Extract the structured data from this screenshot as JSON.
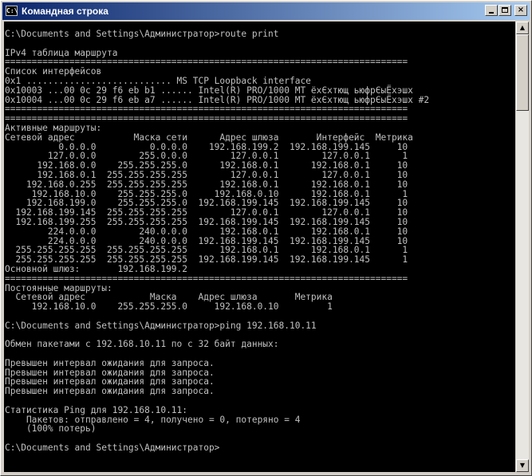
{
  "window": {
    "title": "Командная строка",
    "icon_text": "C:\\"
  },
  "titlebar_buttons": {
    "minimize_icon": "minimize-icon",
    "maximize_icon": "maximize-icon",
    "close_label": "×"
  },
  "scrollbar": {
    "up_arrow": "▲",
    "down_arrow": "▼"
  },
  "console": {
    "lines": [
      "C:\\Documents and Settings\\Администратор>route print",
      "",
      "IPv4 таблица маршрута",
      "===========================================================================",
      "Список интерфейсов",
      "0x1 ........................... MS TCP Loopback interface",
      "0x10003 ...00 0c 29 f6 eb b1 ...... Intel(R) PRO/1000 MT ёхЄхтющ ьюфрЄыЁхэшх",
      "0x10004 ...00 0c 29 f6 eb a7 ...... Intel(R) PRO/1000 MT ёхЄхтющ ьюфрЄыЁхэшх #2",
      "===========================================================================",
      "===========================================================================",
      "Активные маршруты:",
      "Сетевой адрес           Маска сети      Адрес шлюза       Интерфейс  Метрика",
      "          0.0.0.0          0.0.0.0    192.168.199.2  192.168.199.145     10",
      "        127.0.0.0        255.0.0.0        127.0.0.1        127.0.0.1      1",
      "      192.168.0.0    255.255.255.0      192.168.0.1      192.168.0.1     10",
      "      192.168.0.1  255.255.255.255        127.0.0.1        127.0.0.1     10",
      "    192.168.0.255  255.255.255.255      192.168.0.1      192.168.0.1     10",
      "     192.168.10.0    255.255.255.0     192.168.0.10      192.168.0.1      1",
      "    192.168.199.0    255.255.255.0  192.168.199.145  192.168.199.145     10",
      "  192.168.199.145  255.255.255.255        127.0.0.1        127.0.0.1     10",
      "  192.168.199.255  255.255.255.255  192.168.199.145  192.168.199.145     10",
      "        224.0.0.0        240.0.0.0      192.168.0.1      192.168.0.1     10",
      "        224.0.0.0        240.0.0.0  192.168.199.145  192.168.199.145     10",
      "  255.255.255.255  255.255.255.255      192.168.0.1      192.168.0.1      1",
      "  255.255.255.255  255.255.255.255  192.168.199.145  192.168.199.145      1",
      "Основной шлюз:       192.168.199.2",
      "===========================================================================",
      "Постоянные маршруты:",
      "  Сетевой адрес            Маска    Адрес шлюза       Метрика",
      "     192.168.10.0    255.255.255.0     192.168.0.10         1",
      "",
      "C:\\Documents and Settings\\Администратор>ping 192.168.10.11",
      "",
      "Обмен пакетами с 192.168.10.11 по с 32 байт данных:",
      "",
      "Превышен интервал ожидания для запроса.",
      "Превышен интервал ожидания для запроса.",
      "Превышен интервал ожидания для запроса.",
      "Превышен интервал ожидания для запроса.",
      "",
      "Статистика Ping для 192.168.10.11:",
      "    Пакетов: отправлено = 4, получено = 0, потеряно = 4",
      "    (100% потерь)",
      "",
      "C:\\Documents and Settings\\Администратор>"
    ]
  }
}
